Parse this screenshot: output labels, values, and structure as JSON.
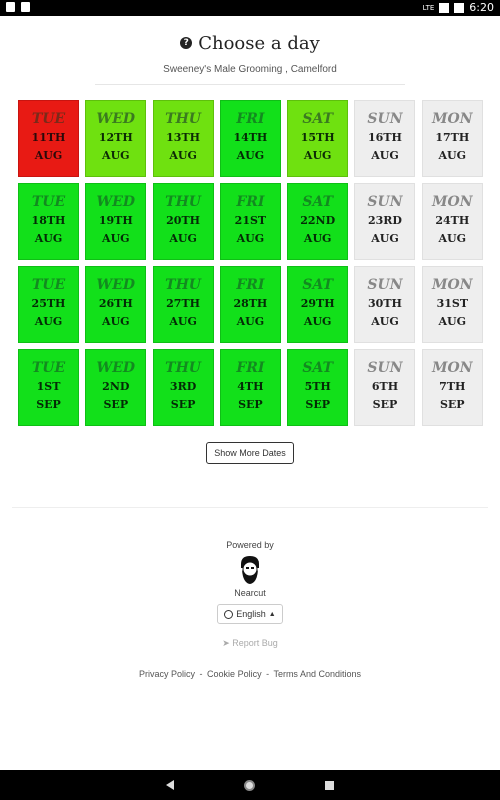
{
  "status_bar": {
    "lte": "LTE",
    "time": "6:20"
  },
  "header": {
    "title": "Choose a day",
    "subtitle": "Sweeney's Male Grooming , Camelford"
  },
  "days": [
    {
      "dow": "TUE",
      "date": "11TH",
      "month": "AUG",
      "status": "red"
    },
    {
      "dow": "WED",
      "date": "12TH",
      "month": "AUG",
      "status": "lime"
    },
    {
      "dow": "THU",
      "date": "13TH",
      "month": "AUG",
      "status": "lime"
    },
    {
      "dow": "FRI",
      "date": "14TH",
      "month": "AUG",
      "status": "green"
    },
    {
      "dow": "SAT",
      "date": "15TH",
      "month": "AUG",
      "status": "lime"
    },
    {
      "dow": "SUN",
      "date": "16TH",
      "month": "AUG",
      "status": "grey"
    },
    {
      "dow": "MON",
      "date": "17TH",
      "month": "AUG",
      "status": "grey"
    },
    {
      "dow": "TUE",
      "date": "18TH",
      "month": "AUG",
      "status": "green"
    },
    {
      "dow": "WED",
      "date": "19TH",
      "month": "AUG",
      "status": "green"
    },
    {
      "dow": "THU",
      "date": "20TH",
      "month": "AUG",
      "status": "green"
    },
    {
      "dow": "FRI",
      "date": "21ST",
      "month": "AUG",
      "status": "green"
    },
    {
      "dow": "SAT",
      "date": "22ND",
      "month": "AUG",
      "status": "green"
    },
    {
      "dow": "SUN",
      "date": "23RD",
      "month": "AUG",
      "status": "grey"
    },
    {
      "dow": "MON",
      "date": "24TH",
      "month": "AUG",
      "status": "grey"
    },
    {
      "dow": "TUE",
      "date": "25TH",
      "month": "AUG",
      "status": "green"
    },
    {
      "dow": "WED",
      "date": "26TH",
      "month": "AUG",
      "status": "green"
    },
    {
      "dow": "THU",
      "date": "27TH",
      "month": "AUG",
      "status": "green"
    },
    {
      "dow": "FRI",
      "date": "28TH",
      "month": "AUG",
      "status": "green"
    },
    {
      "dow": "SAT",
      "date": "29TH",
      "month": "AUG",
      "status": "green"
    },
    {
      "dow": "SUN",
      "date": "30TH",
      "month": "AUG",
      "status": "grey"
    },
    {
      "dow": "MON",
      "date": "31ST",
      "month": "AUG",
      "status": "grey"
    },
    {
      "dow": "TUE",
      "date": "1ST",
      "month": "SEP",
      "status": "green"
    },
    {
      "dow": "WED",
      "date": "2ND",
      "month": "SEP",
      "status": "green"
    },
    {
      "dow": "THU",
      "date": "3RD",
      "month": "SEP",
      "status": "green"
    },
    {
      "dow": "FRI",
      "date": "4TH",
      "month": "SEP",
      "status": "green"
    },
    {
      "dow": "SAT",
      "date": "5TH",
      "month": "SEP",
      "status": "green"
    },
    {
      "dow": "SUN",
      "date": "6TH",
      "month": "SEP",
      "status": "grey"
    },
    {
      "dow": "MON",
      "date": "7TH",
      "month": "SEP",
      "status": "grey"
    }
  ],
  "show_more_label": "Show More Dates",
  "footer": {
    "powered_by": "Powered by",
    "brand": "Nearcut",
    "language": "English",
    "report_bug": "Report Bug",
    "links": [
      "Privacy Policy",
      "Cookie Policy",
      "Terms And Conditions"
    ],
    "link_separator": "-"
  },
  "colors": {
    "red": "#e81a14",
    "lime": "#6fe110",
    "green": "#12e01a",
    "grey": "#eeeeee"
  }
}
